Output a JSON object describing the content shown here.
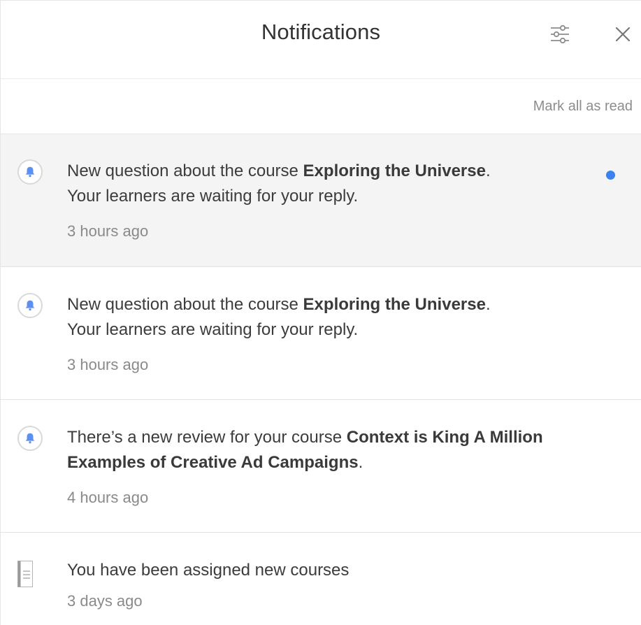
{
  "header": {
    "title": "Notifications",
    "settings_icon": "sliders-icon",
    "close_icon": "close-icon"
  },
  "actions": {
    "mark_all_read": "Mark all as read"
  },
  "notifications": [
    {
      "icon": "bell-icon",
      "unread": true,
      "text_prefix": "New question about the course ",
      "text_bold": "Exploring the Universe",
      "text_suffix": ".",
      "text_line2": "Your learners are waiting for your reply.",
      "time": "3 hours ago"
    },
    {
      "icon": "bell-icon",
      "unread": false,
      "text_prefix": "New question about the course ",
      "text_bold": "Exploring the Universe",
      "text_suffix": ".",
      "text_line2": "Your learners are waiting for your reply.",
      "time": "3 hours ago"
    },
    {
      "icon": "bell-icon",
      "unread": false,
      "text_prefix": "There’s a new review for your course ",
      "text_bold": "Context is King A Million Examples of Creative Ad Campaigns",
      "text_suffix": ".",
      "time": "4 hours ago"
    },
    {
      "icon": "document-icon",
      "unread": false,
      "text": "You have been assigned new courses",
      "time": "3 days ago"
    }
  ],
  "colors": {
    "unread_dot": "#3b82f0",
    "bell": "#5b8ff0",
    "unread_background": "#f4f4f4"
  }
}
